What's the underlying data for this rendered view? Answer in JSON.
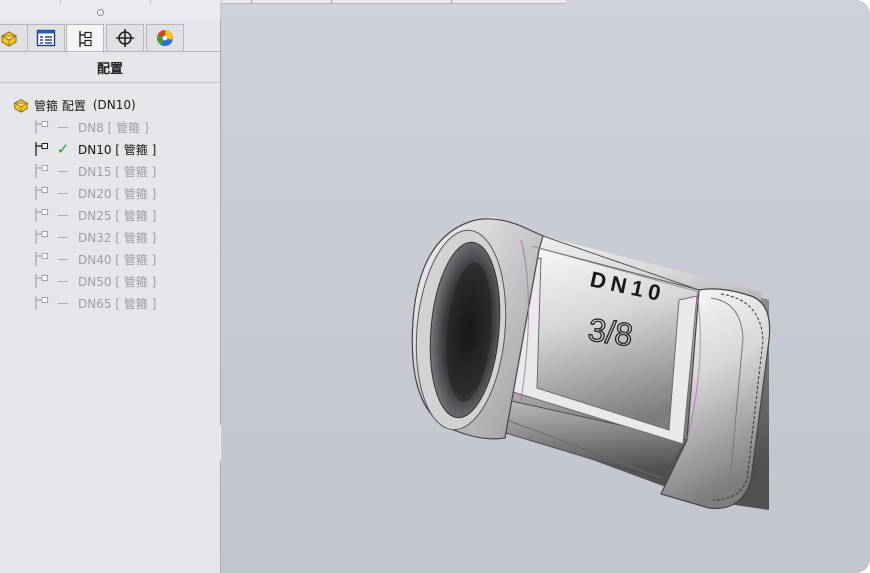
{
  "panel": {
    "title": "配置",
    "tabs": [
      {
        "icon": "part-icon"
      },
      {
        "icon": "property-manager-icon"
      },
      {
        "icon": "configuration-manager-icon",
        "active": true
      },
      {
        "icon": "dimxpert-icon"
      },
      {
        "icon": "display-manager-icon"
      }
    ]
  },
  "tree": {
    "root": {
      "name": "管箍 配置",
      "active_config": "(DN10)"
    },
    "configs": [
      {
        "label": "DN8 [ 管箍 ]",
        "active": false
      },
      {
        "label": "DN10 [ 管箍 ]",
        "active": true
      },
      {
        "label": "DN15 [ 管箍 ]",
        "active": false
      },
      {
        "label": "DN20 [ 管箍 ]",
        "active": false
      },
      {
        "label": "DN25 [ 管箍 ]",
        "active": false
      },
      {
        "label": "DN32 [ 管箍 ]",
        "active": false
      },
      {
        "label": "DN40 [ 管箍 ]",
        "active": false
      },
      {
        "label": "DN50 [ 管箍 ]",
        "active": false
      },
      {
        "label": "DN65 [ 管箍 ]",
        "active": false
      }
    ]
  },
  "model": {
    "engraving_top": "DN10",
    "engraving_bottom": "3/8"
  },
  "colors": {
    "viewport_bg": "#c6c9d1",
    "panel_bg": "#e4e6e9",
    "check_green": "#2aa12a",
    "inactive_text": "#9b9fa6"
  }
}
